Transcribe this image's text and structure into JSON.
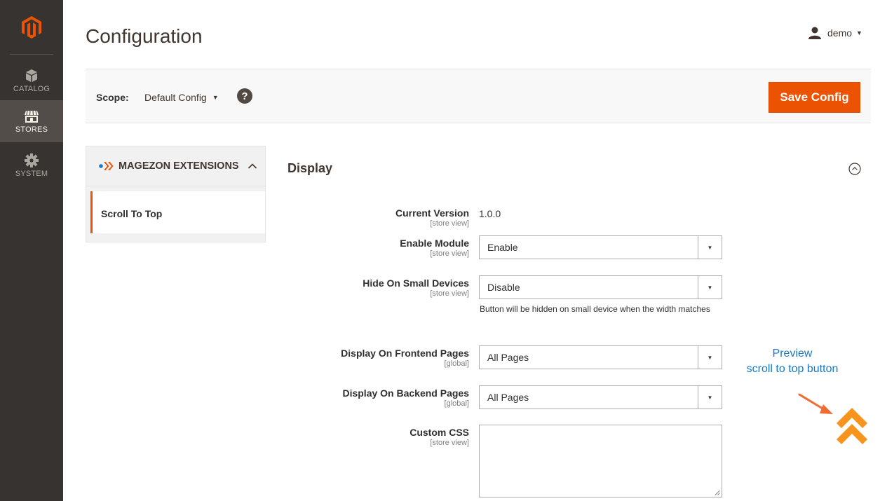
{
  "sidebar": {
    "logo": "magento-logo",
    "items": [
      {
        "label": "CATALOG",
        "icon": "box-icon"
      },
      {
        "label": "STORES",
        "icon": "storefront-icon",
        "active": true
      },
      {
        "label": "SYSTEM",
        "icon": "gear-icon"
      }
    ]
  },
  "header": {
    "title": "Configuration",
    "user": "demo"
  },
  "scope": {
    "label": "Scope:",
    "value": "Default Config",
    "help": "?",
    "save_label": "Save Config"
  },
  "tabs": {
    "group_label": "MAGEZON EXTENSIONS",
    "items": [
      {
        "label": "Scroll To Top"
      }
    ]
  },
  "section": {
    "title": "Display",
    "fields": [
      {
        "label": "Current Version",
        "scope": "[store view]",
        "value": "1.0.0"
      },
      {
        "label": "Enable Module",
        "scope": "[store view]",
        "value": "Enable"
      },
      {
        "label": "Hide On Small Devices",
        "scope": "[store view]",
        "value": "Disable",
        "note": "Button will be hidden on small device when the width matches"
      },
      {
        "label": "Display On Frontend Pages",
        "scope": "[global]",
        "value": "All Pages"
      },
      {
        "label": "Display On Backend Pages",
        "scope": "[global]",
        "value": "All Pages"
      },
      {
        "label": "Custom CSS",
        "scope": "[store view]",
        "value": ""
      }
    ]
  },
  "preview": {
    "line1": "Preview",
    "line2": "scroll to top button"
  },
  "colors": {
    "sidebar_bg": "#373330",
    "accent": "#eb5202",
    "scroll_button": "#f7941d",
    "annotation": "#1979c3"
  }
}
